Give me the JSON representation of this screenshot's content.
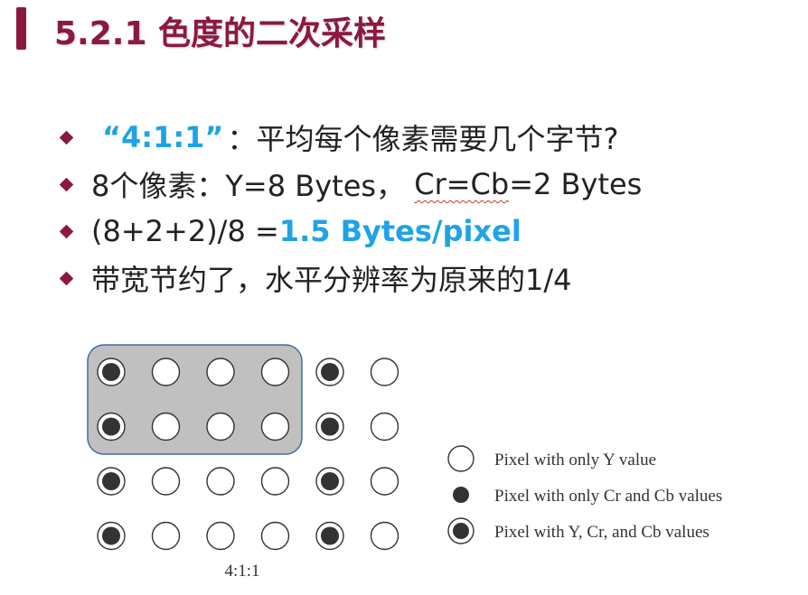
{
  "slide": {
    "title": "5.2.1 色度的二次采样"
  },
  "bullets": [
    {
      "quote": "“4:1:1”",
      "rest": "：平均每个像素需要几个字节?"
    },
    {
      "pre": "8个像素：Y=8 Bytes， ",
      "cb_word": "Cr=Cb",
      "post": "=2 Bytes"
    },
    {
      "pre": "(8+2+2)/8 =",
      "highlight": "1.5 Bytes/pixel"
    },
    {
      "text": "带宽节约了，水平分辨率为原来的1/4"
    }
  ],
  "diagram": {
    "caption": "4:1:1",
    "grid": [
      [
        "both",
        "y",
        "y",
        "y",
        "both",
        "y"
      ],
      [
        "both",
        "y",
        "y",
        "y",
        "both",
        "y"
      ],
      [
        "both",
        "y",
        "y",
        "y",
        "both",
        "y"
      ],
      [
        "both",
        "y",
        "y",
        "y",
        "both",
        "y"
      ]
    ],
    "highlight_group": "first 4 columns × 2 rows",
    "legend": [
      {
        "symbol": "y",
        "label": "Pixel with only Y value"
      },
      {
        "symbol": "cbcr",
        "label": "Pixel with only Cr and Cb values"
      },
      {
        "symbol": "both",
        "label": "Pixel with Y, Cr, and Cb values"
      }
    ]
  },
  "colors": {
    "title": "#8b1a3e",
    "accent": "#1fa3e6",
    "highlight_box": "#c0c0c0",
    "highlight_border": "#3a6ea5"
  }
}
